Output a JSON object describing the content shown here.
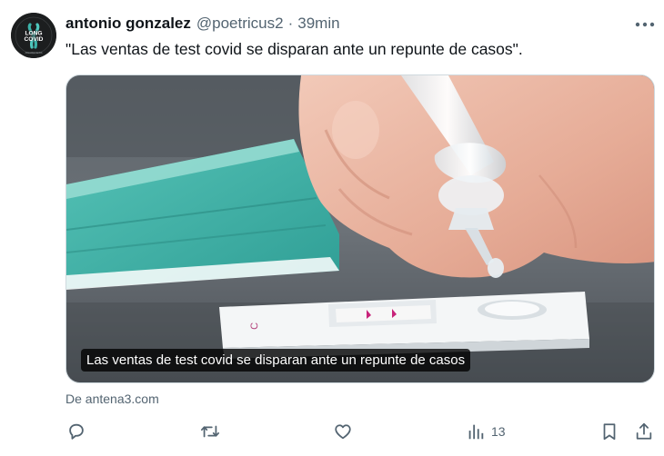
{
  "tweet": {
    "author_name": "antonio gonzalez",
    "handle": "@poetricus2",
    "separator": "·",
    "time": "39min",
    "text": "\"Las ventas de test covid se disparan ante un repunte de casos\".",
    "avatar": {
      "top_text": "LONG COVID",
      "line1": "LONG",
      "line2": "COVID",
      "bottom_text": "AWARENESS"
    },
    "card": {
      "caption": "Las ventas de test covid se disparan ante un repunte de casos",
      "source": "De antena3.com"
    },
    "actions": {
      "reply_icon": "reply-icon",
      "retweet_icon": "retweet-icon",
      "like_icon": "heart-icon",
      "views_icon": "views-chart-icon",
      "views_count": "13",
      "bookmark_icon": "bookmark-icon",
      "share_icon": "share-icon"
    },
    "colors": {
      "text_primary": "#0f1419",
      "text_secondary": "#536471",
      "border": "#cfd9de"
    }
  }
}
